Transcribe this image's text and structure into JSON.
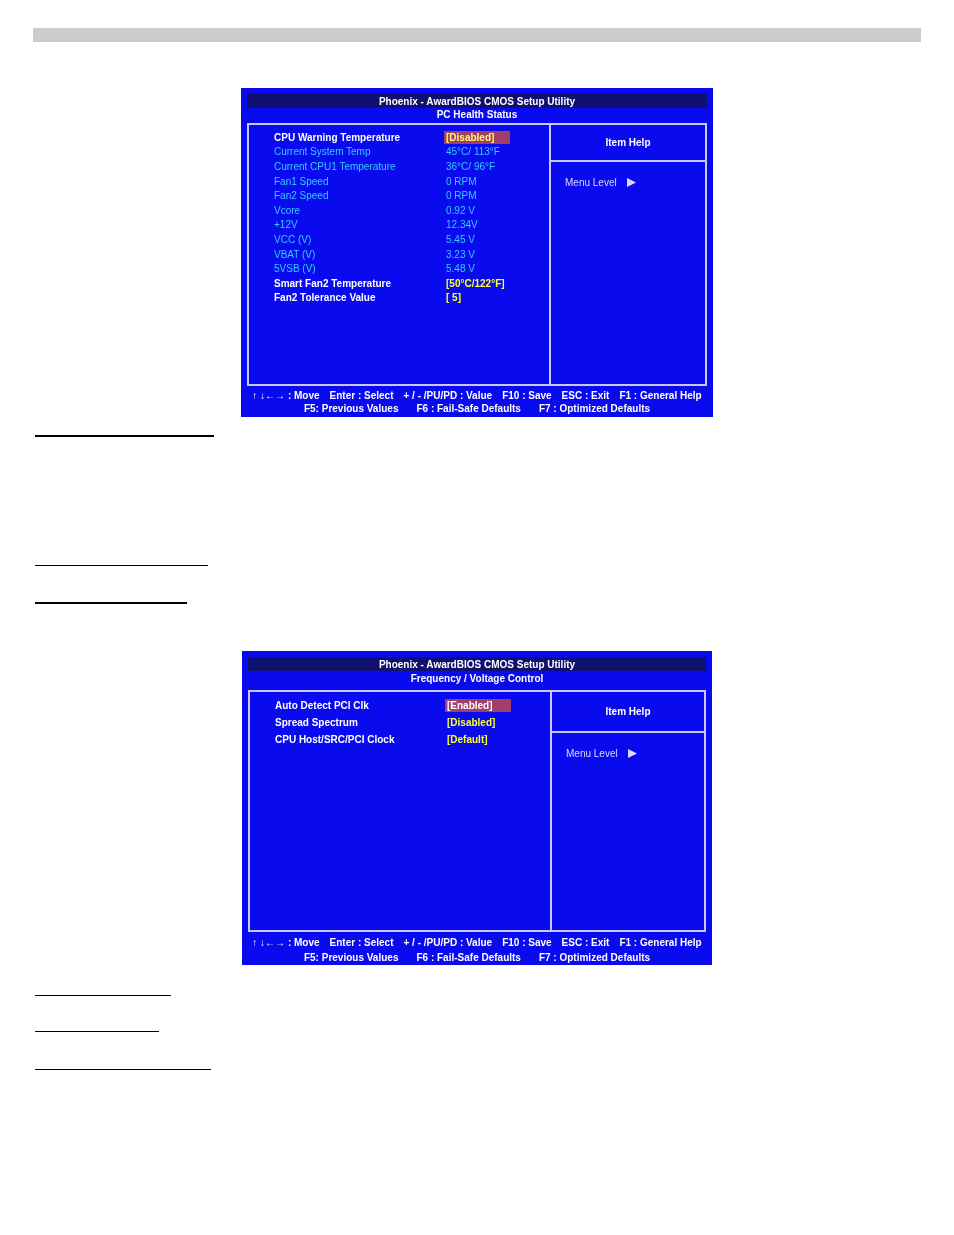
{
  "screens": [
    {
      "title": "Phoenix - AwardBIOS CMOS Setup Utility",
      "subtitle": "PC Health Status",
      "help_title": "Item Help",
      "menu_level": "Menu Level",
      "items": [
        {
          "kind": "setting",
          "label": "CPU Warning Temperature",
          "value": "[Disabled]",
          "selected": true
        },
        {
          "kind": "reading",
          "label": "Current System Temp",
          "value": "45°C/ 113°F",
          "selected": false
        },
        {
          "kind": "reading",
          "label": "Current CPU1 Temperature",
          "value": "36°C/  96°F",
          "selected": false
        },
        {
          "kind": "reading",
          "label": "Fan1 Speed",
          "value": "0 RPM",
          "selected": false
        },
        {
          "kind": "reading",
          "label": "Fan2 Speed",
          "value": "0 RPM",
          "selected": false
        },
        {
          "kind": "reading",
          "label": "Vcore",
          "value": "0.92 V",
          "selected": false
        },
        {
          "kind": "reading",
          "label": "+12V",
          "value": "12.34V",
          "selected": false
        },
        {
          "kind": "reading",
          "label": "VCC (V)",
          "value": "5.45 V",
          "selected": false
        },
        {
          "kind": "reading",
          "label": "VBAT (V)",
          "value": "3.23 V",
          "selected": false
        },
        {
          "kind": "reading",
          "label": "5VSB (V)",
          "value": "5.48 V",
          "selected": false
        },
        {
          "kind": "setting",
          "label": "Smart Fan2 Temperature",
          "value": "[50°C/122°F]",
          "selected": false
        },
        {
          "kind": "setting",
          "label": "Fan2 Tolerance Value",
          "value": "[ 5]",
          "selected": false
        }
      ],
      "footer": [
        [
          "↑ ↓←→ : Move",
          "Enter : Select",
          "+ / - /PU/PD : Value",
          "F10 : Save",
          "ESC : Exit",
          "F1 : General Help"
        ],
        [
          "F5: Previous Values",
          "F6 : Fail-Safe Defaults",
          "F7 : Optimized Defaults"
        ]
      ]
    },
    {
      "title": "Phoenix - AwardBIOS CMOS Setup Utility",
      "subtitle": "Frequency / Voltage Control",
      "help_title": "Item Help",
      "menu_level": "Menu Level",
      "items": [
        {
          "kind": "setting",
          "label": "Auto Detect PCI Clk",
          "value": "[Enabled]",
          "selected": true
        },
        {
          "kind": "setting",
          "label": "Spread Spectrum",
          "value": "[Disabled]",
          "selected": false
        },
        {
          "kind": "setting",
          "label": "CPU Host/SRC/PCI Clock",
          "value": "[Default]",
          "selected": false
        }
      ],
      "footer": [
        [
          "↑ ↓←→ : Move",
          "Enter : Select",
          "+ / - /PU/PD : Value",
          "F10 : Save",
          "ESC : Exit",
          "F1 : General Help"
        ],
        [
          "F5: Previous Values",
          "F6 : Fail-Safe Defaults",
          "F7 : Optimized Defaults"
        ]
      ]
    }
  ]
}
